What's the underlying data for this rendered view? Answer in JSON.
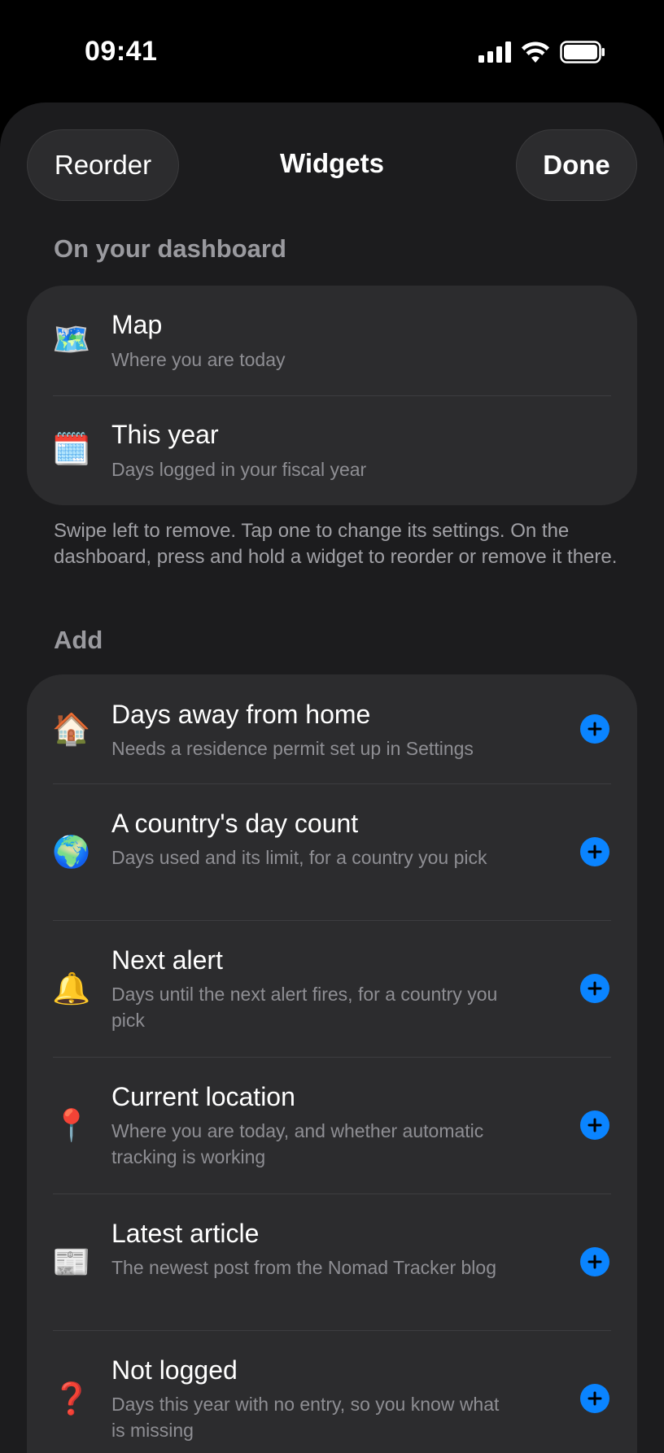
{
  "status": {
    "time": "09:41",
    "signal_icon": "cellular-signal-icon",
    "wifi_icon": "wifi-icon",
    "battery_icon": "battery-icon"
  },
  "nav": {
    "reorder_label": "Reorder",
    "title": "Widgets",
    "done_label": "Done"
  },
  "dashboard": {
    "header": "On your dashboard",
    "items": [
      {
        "emoji": "🗺️",
        "icon": "map-icon",
        "title": "Map",
        "subtitle": "Where you are today"
      },
      {
        "emoji": "🗓️",
        "icon": "calendar-icon",
        "title": "This year",
        "subtitle": "Days logged in your fiscal year"
      }
    ],
    "note": "Swipe left to remove. Tap one to change its settings. On the dashboard, press and hold a widget to reorder or remove it there."
  },
  "add": {
    "header": "Add",
    "items": [
      {
        "emoji": "🏠",
        "icon": "house-icon",
        "title": "Days away from home",
        "subtitle": "Needs a residence permit set up in Settings"
      },
      {
        "emoji": "🌍",
        "icon": "globe-icon",
        "title": "A country's day count",
        "subtitle": "Days used and its limit, for a country you pick"
      },
      {
        "emoji": "🔔",
        "icon": "bell-icon",
        "title": "Next alert",
        "subtitle": "Days until the next alert fires, for a country you pick"
      },
      {
        "emoji": "📍",
        "icon": "pin-icon",
        "title": "Current location",
        "subtitle": "Where you are today, and whether automatic tracking is working"
      },
      {
        "emoji": "📰",
        "icon": "newspaper-icon",
        "title": "Latest article",
        "subtitle": "The newest post from the Nomad Tracker blog"
      },
      {
        "emoji": "❓",
        "icon": "question-mark-icon",
        "title": "Not logged",
        "subtitle": "Days this year with no entry, so you know what is missing"
      }
    ]
  },
  "colors": {
    "accent": "#0a84ff",
    "sheet_background": "#1c1c1e",
    "card_background": "#2c2c2e",
    "secondary_text": "#8e8e93"
  }
}
